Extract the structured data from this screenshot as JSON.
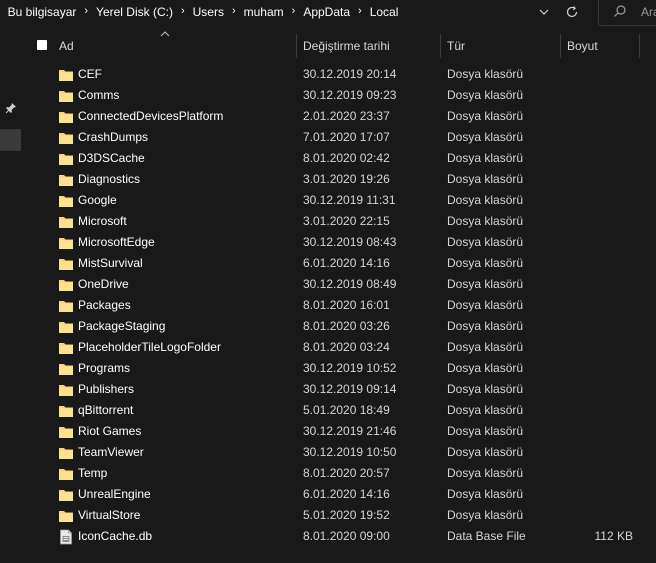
{
  "breadcrumb": [
    "Bu bilgisayar",
    "Yerel Disk (C:)",
    "Users",
    "muham",
    "AppData",
    "Local"
  ],
  "search": {
    "placeholder": "Ara"
  },
  "columns": {
    "name": "Ad",
    "date": "Değiştirme tarihi",
    "type": "Tür",
    "size": "Boyut"
  },
  "colors": {
    "background": "#191919",
    "folder": "#f8d775",
    "separator": "#3b3b3b",
    "selected_nav": "#3a3a3a"
  },
  "files": [
    {
      "name": "CEF",
      "date": "30.12.2019 20:14",
      "type": "Dosya klasörü",
      "size": "",
      "icon": "folder-icon"
    },
    {
      "name": "Comms",
      "date": "30.12.2019 09:23",
      "type": "Dosya klasörü",
      "size": "",
      "icon": "folder-icon"
    },
    {
      "name": "ConnectedDevicesPlatform",
      "date": "2.01.2020 23:37",
      "type": "Dosya klasörü",
      "size": "",
      "icon": "folder-icon"
    },
    {
      "name": "CrashDumps",
      "date": "7.01.2020 17:07",
      "type": "Dosya klasörü",
      "size": "",
      "icon": "folder-icon"
    },
    {
      "name": "D3DSCache",
      "date": "8.01.2020 02:42",
      "type": "Dosya klasörü",
      "size": "",
      "icon": "folder-icon"
    },
    {
      "name": "Diagnostics",
      "date": "3.01.2020 19:26",
      "type": "Dosya klasörü",
      "size": "",
      "icon": "folder-icon"
    },
    {
      "name": "Google",
      "date": "30.12.2019 11:31",
      "type": "Dosya klasörü",
      "size": "",
      "icon": "folder-icon"
    },
    {
      "name": "Microsoft",
      "date": "3.01.2020 22:15",
      "type": "Dosya klasörü",
      "size": "",
      "icon": "folder-icon"
    },
    {
      "name": "MicrosoftEdge",
      "date": "30.12.2019 08:43",
      "type": "Dosya klasörü",
      "size": "",
      "icon": "folder-icon"
    },
    {
      "name": "MistSurvival",
      "date": "6.01.2020 14:16",
      "type": "Dosya klasörü",
      "size": "",
      "icon": "folder-icon"
    },
    {
      "name": "OneDrive",
      "date": "30.12.2019 08:49",
      "type": "Dosya klasörü",
      "size": "",
      "icon": "folder-icon"
    },
    {
      "name": "Packages",
      "date": "8.01.2020 16:01",
      "type": "Dosya klasörü",
      "size": "",
      "icon": "folder-icon"
    },
    {
      "name": "PackageStaging",
      "date": "8.01.2020 03:26",
      "type": "Dosya klasörü",
      "size": "",
      "icon": "folder-icon"
    },
    {
      "name": "PlaceholderTileLogoFolder",
      "date": "8.01.2020 03:24",
      "type": "Dosya klasörü",
      "size": "",
      "icon": "folder-icon"
    },
    {
      "name": "Programs",
      "date": "30.12.2019 10:52",
      "type": "Dosya klasörü",
      "size": "",
      "icon": "folder-icon"
    },
    {
      "name": "Publishers",
      "date": "30.12.2019 09:14",
      "type": "Dosya klasörü",
      "size": "",
      "icon": "folder-icon"
    },
    {
      "name": "qBittorrent",
      "date": "5.01.2020 18:49",
      "type": "Dosya klasörü",
      "size": "",
      "icon": "folder-icon"
    },
    {
      "name": "Riot Games",
      "date": "30.12.2019 21:46",
      "type": "Dosya klasörü",
      "size": "",
      "icon": "folder-icon"
    },
    {
      "name": "TeamViewer",
      "date": "30.12.2019 10:50",
      "type": "Dosya klasörü",
      "size": "",
      "icon": "folder-icon"
    },
    {
      "name": "Temp",
      "date": "8.01.2020 20:57",
      "type": "Dosya klasörü",
      "size": "",
      "icon": "folder-icon"
    },
    {
      "name": "UnrealEngine",
      "date": "6.01.2020 14:16",
      "type": "Dosya klasörü",
      "size": "",
      "icon": "folder-icon"
    },
    {
      "name": "VirtualStore",
      "date": "5.01.2020 19:52",
      "type": "Dosya klasörü",
      "size": "",
      "icon": "folder-icon"
    },
    {
      "name": "IconCache.db",
      "date": "8.01.2020 09:00",
      "type": "Data Base File",
      "size": "112 KB",
      "icon": "db-file-icon"
    }
  ]
}
